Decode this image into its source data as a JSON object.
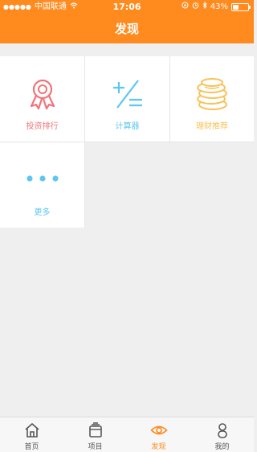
{
  "statusbar": {
    "carrier": "中国联通",
    "time": "17:06",
    "battery": "43%"
  },
  "header": {
    "title": "发现"
  },
  "grid": {
    "items": [
      {
        "label": "投资排行",
        "icon": "award-ribbon-icon",
        "color": "#f0747a"
      },
      {
        "label": "计算器",
        "icon": "calculator-icon",
        "color": "#5cc7ef"
      },
      {
        "label": "理财推荐",
        "icon": "coins-stack-icon",
        "color": "#f7c25a"
      },
      {
        "label": "更多",
        "icon": "more-dots-icon",
        "color": "#5cc7ef"
      }
    ]
  },
  "tabbar": {
    "tabs": [
      {
        "label": "首页",
        "icon": "home-icon"
      },
      {
        "label": "项目",
        "icon": "stacked-cards-icon"
      },
      {
        "label": "发现",
        "icon": "eye-icon",
        "active": true
      },
      {
        "label": "我的",
        "icon": "person-icon"
      }
    ],
    "active_color": "#ff8a1e"
  }
}
